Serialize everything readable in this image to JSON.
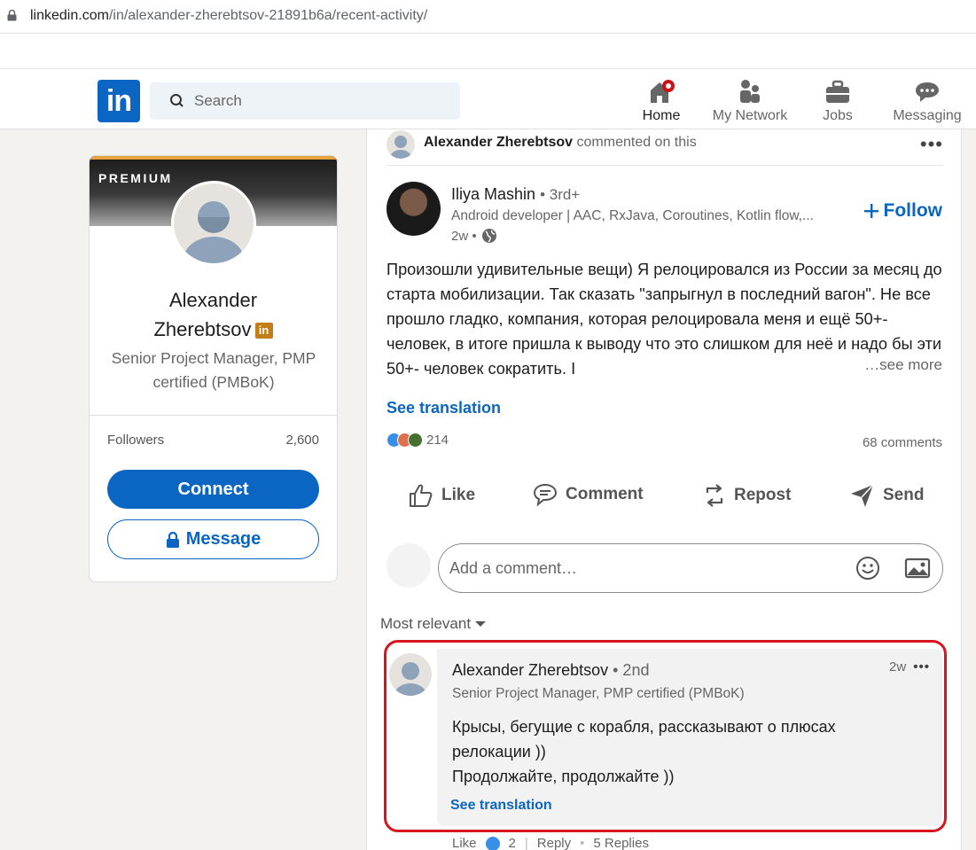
{
  "browser": {
    "url_host": "linkedin.com",
    "url_path": "/in/alexander-zherebtsov-21891b6a/recent-activity/"
  },
  "nav": {
    "logo_text": "in",
    "search_placeholder": "Search",
    "items": [
      {
        "label": "Home",
        "icon": "home-icon"
      },
      {
        "label": "My Network",
        "icon": "network-icon"
      },
      {
        "label": "Jobs",
        "icon": "briefcase-icon"
      },
      {
        "label": "Messaging",
        "icon": "messaging-icon"
      }
    ]
  },
  "profile": {
    "premium_label": "PREMIUM",
    "name_line1": "Alexander",
    "name_line2": "Zherebtsov",
    "badge": "in",
    "headline": "Senior Project Manager, PMP certified (PMBoK)",
    "followers_label": "Followers",
    "followers_count": "2,600",
    "connect_label": "Connect",
    "message_label": "Message"
  },
  "activity": {
    "actor": "Alexander Zherebtsov",
    "action": "commented on this"
  },
  "post": {
    "author": "Iliya Mashin",
    "degree": "• 3rd+",
    "subtitle": "Android developer | AAC, RxJava, Coroutines, Kotlin flow,...",
    "time": "2w •",
    "follow_label": "Follow",
    "body": "Произошли удивительные вещи) Я релоцировался из России за месяц до старта мобилизации. Так сказать \"запрыгнул в последний вагон\". Не все прошло гладко, компания, которая релоцировала меня и ещё 50+- человек, в итоге пришла к выводу что это слишком для неё и надо бы эти 50+- человек сократить. I",
    "see_more": "…see more",
    "see_translation": "See translation",
    "reaction_count": "214",
    "comments_count": "68 comments",
    "actions": [
      "Like",
      "Comment",
      "Repost",
      "Send"
    ],
    "comment_placeholder": "Add a comment…",
    "sort_label": "Most relevant"
  },
  "comment": {
    "author": "Alexander Zherebtsov",
    "degree": "• 2nd",
    "headline": "Senior Project Manager, PMP certified (PMBoK)",
    "time": "2w",
    "text_line1": "Крысы, бегущие с корабля, рассказывают о плюсах",
    "text_line2": "релокации ))",
    "text_line3": "Продолжайте, продолжайте ))",
    "see_translation": "See translation",
    "like_label": "Like",
    "like_count": "2",
    "reply_label": "Reply",
    "replies_label": "5 Replies"
  },
  "colors": {
    "linkedin_blue": "#0a66c2",
    "highlight_red": "#d6151f",
    "premium_gold": "#e7a33e"
  }
}
